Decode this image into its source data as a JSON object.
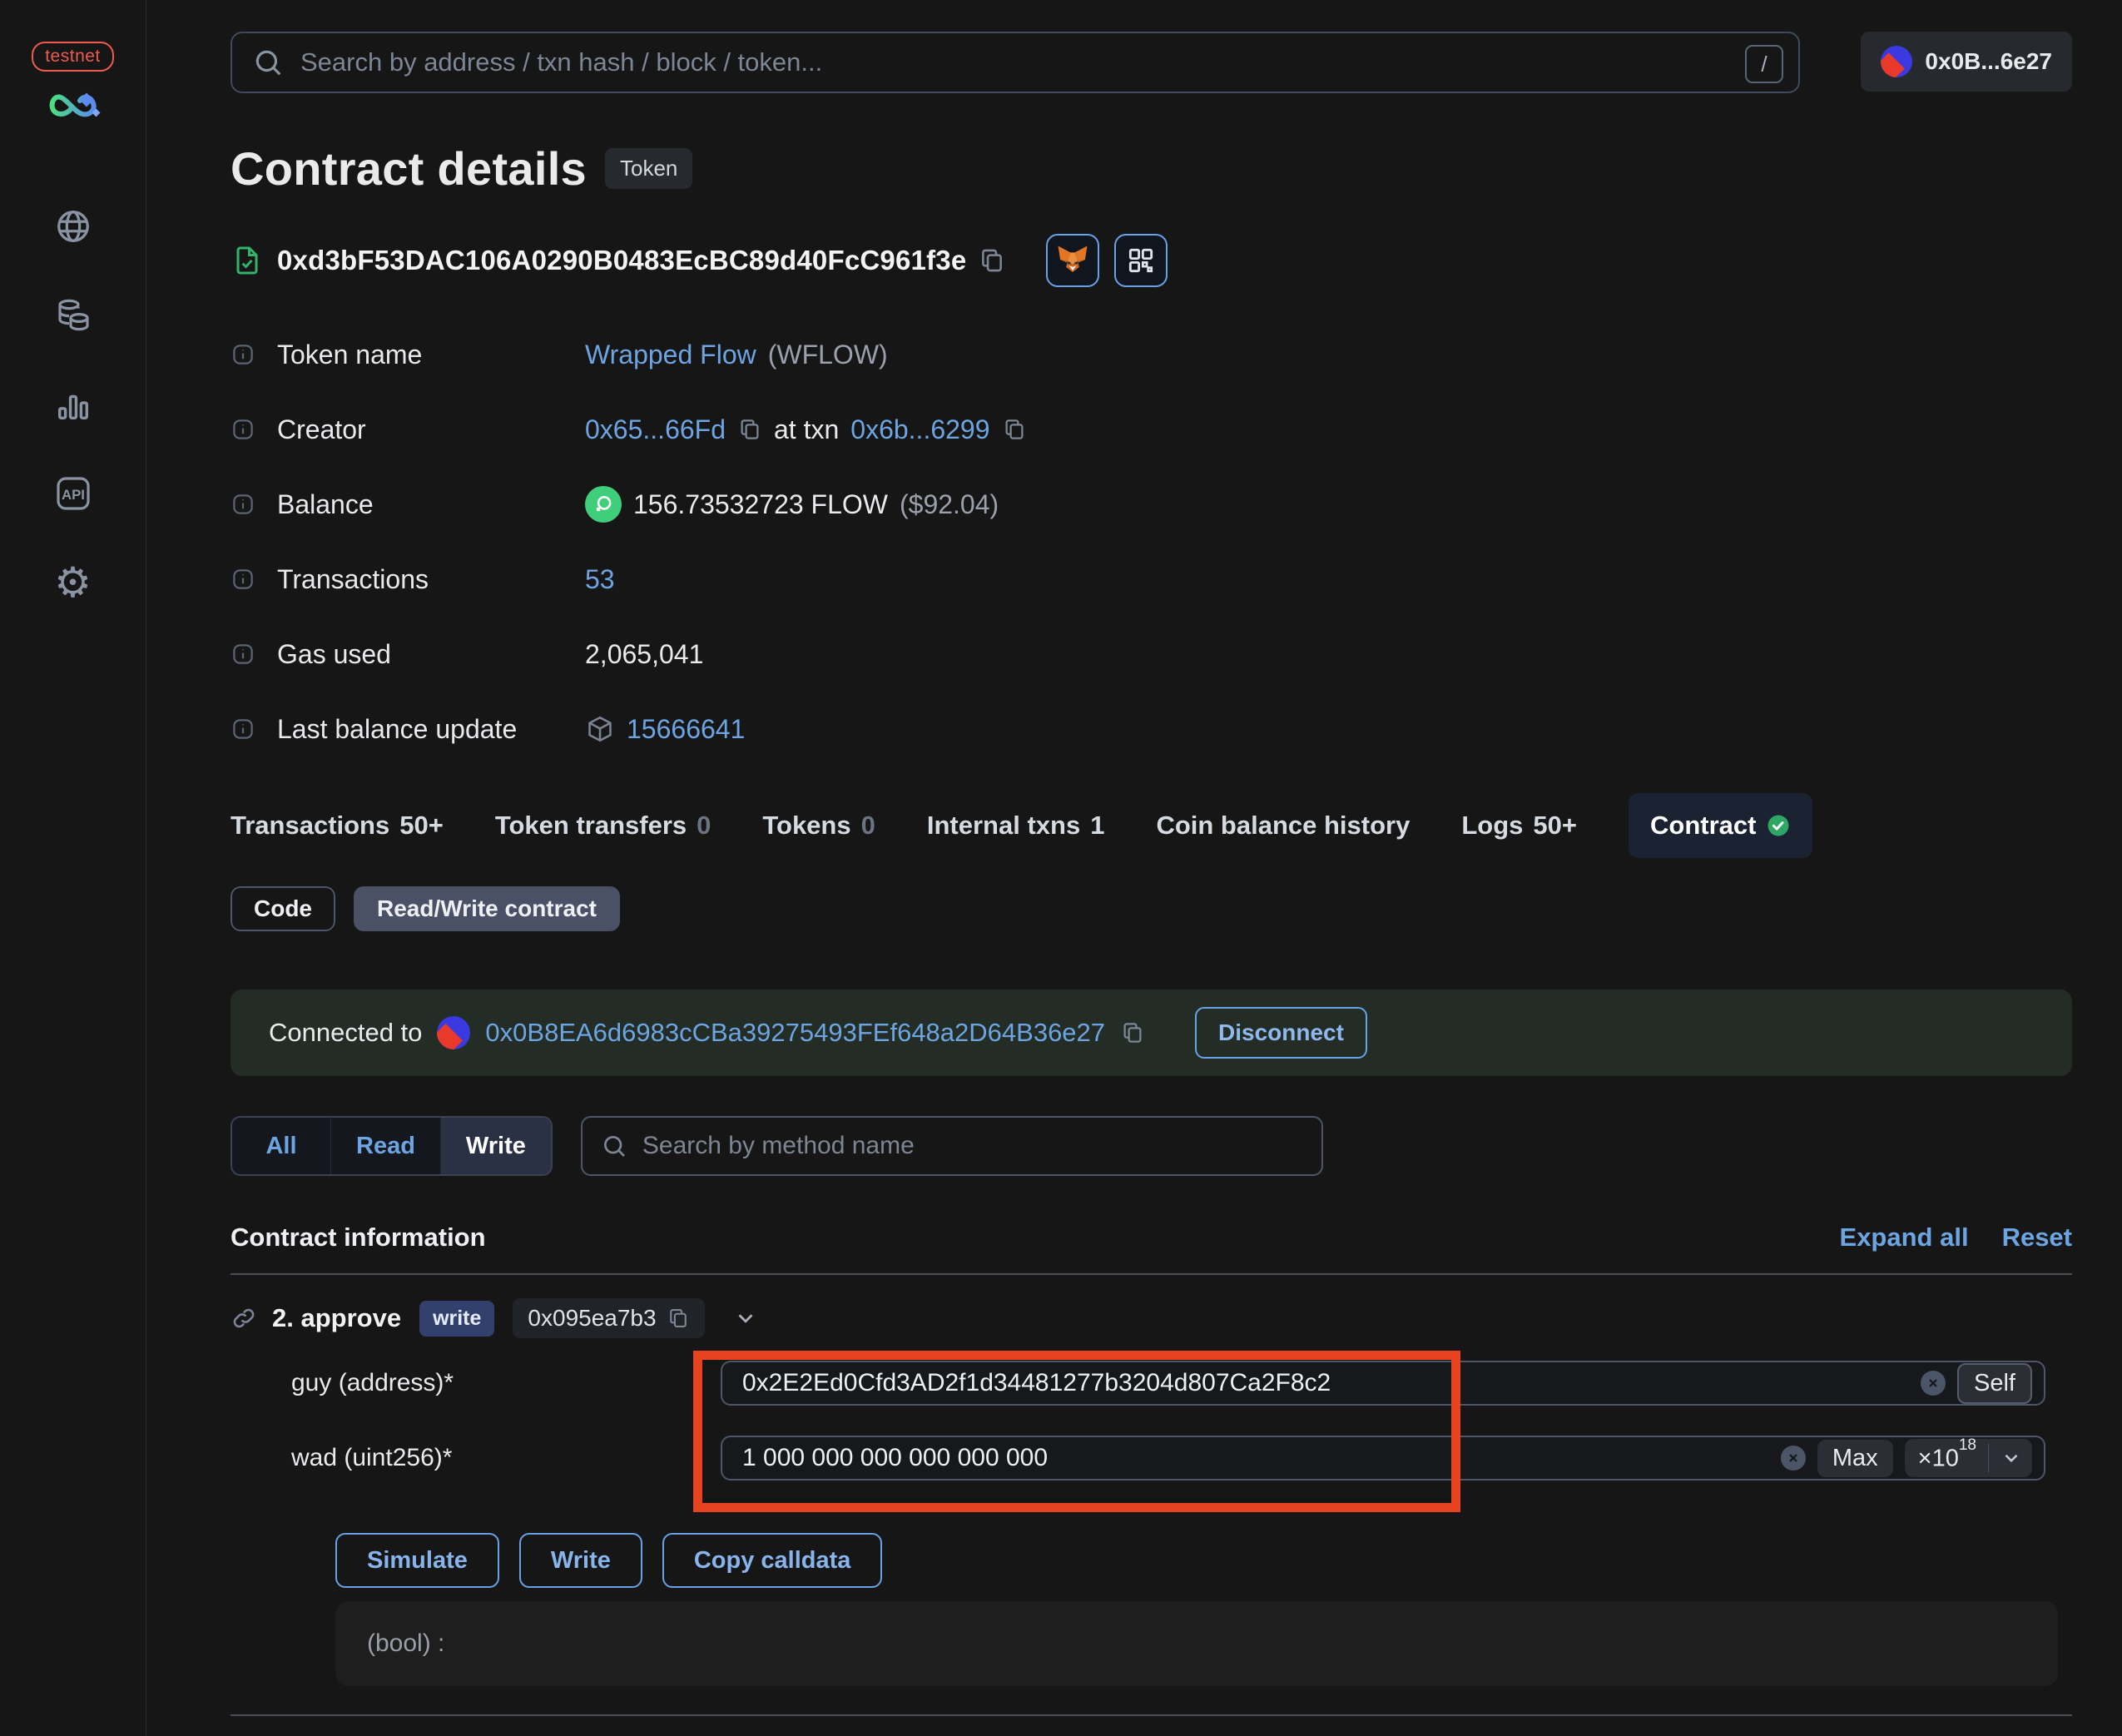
{
  "colors": {
    "background": "#161616",
    "accent_blue": "#6da5e3",
    "annotation_red": "#e8431f",
    "verified_green": "#35b26a",
    "flow_green": "#3fcf7a",
    "testnet_red": "#ee5a4f"
  },
  "sidebar": {
    "network_badge": "testnet",
    "icons": [
      "globe",
      "coins",
      "bar-chart",
      "api",
      "gear"
    ]
  },
  "topbar": {
    "search_placeholder": "Search by address / txn hash / block / token...",
    "shortcut_hint": "/",
    "account_address_short": "0x0B...6e27"
  },
  "header": {
    "title": "Contract details",
    "badge": "Token",
    "address": "0xd3bF53DAC106A0290B0483EcBC89d40FcC961f3e"
  },
  "info": {
    "token_name": {
      "label": "Token name",
      "link": "Wrapped Flow",
      "suffix": "(WFLOW)"
    },
    "creator": {
      "label": "Creator",
      "address": "0x65...66Fd",
      "middle": "at txn",
      "txn": "0x6b...6299"
    },
    "balance": {
      "label": "Balance",
      "value": "156.73532723 FLOW",
      "usd": "($92.04)"
    },
    "transactions": {
      "label": "Transactions",
      "value": "53"
    },
    "gas_used": {
      "label": "Gas used",
      "value": "2,065,041"
    },
    "last_balance_update": {
      "label": "Last balance update",
      "value": "15666641"
    }
  },
  "tabs": [
    {
      "label": "Transactions",
      "count": "50+"
    },
    {
      "label": "Token transfers",
      "count": "0"
    },
    {
      "label": "Tokens",
      "count": "0"
    },
    {
      "label": "Internal txns",
      "count": "1"
    },
    {
      "label": "Coin balance history",
      "count": ""
    },
    {
      "label": "Logs",
      "count": "50+"
    },
    {
      "label": "Contract",
      "count": ""
    }
  ],
  "subtabs": {
    "code": "Code",
    "read_write": "Read/Write contract"
  },
  "connection": {
    "prefix": "Connected to",
    "address": "0x0B8EA6d6983cCBa39275493FEf648a2D64B36e27",
    "disconnect": "Disconnect"
  },
  "filter": {
    "all": "All",
    "read": "Read",
    "write": "Write",
    "search_placeholder": "Search by method name"
  },
  "contract_info": {
    "title": "Contract information",
    "expand_all": "Expand all",
    "reset": "Reset"
  },
  "method": {
    "name": "2. approve",
    "badge": "write",
    "selector": "0x095ea7b3",
    "fields": [
      {
        "label": "guy (address)*",
        "value": "0x2E2Ed0Cfd3AD2f1d34481277b3204d807Ca2F8c2",
        "action": "Self"
      },
      {
        "label": "wad (uint256)*",
        "value": "1 000 000 000 000 000 000",
        "action": "Max",
        "multiplier": "×10",
        "exponent": "18"
      }
    ],
    "buttons": [
      "Simulate",
      "Write",
      "Copy calldata"
    ],
    "output": "(bool) :"
  }
}
